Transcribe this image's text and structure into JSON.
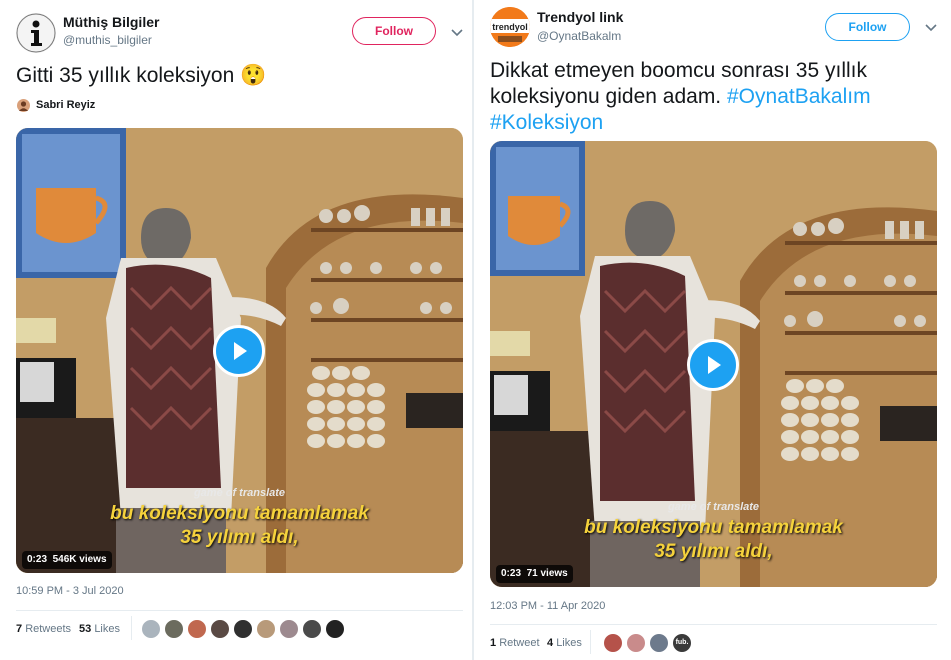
{
  "tweet1": {
    "name": "Müthiş Bilgiler",
    "handle": "@muthis_bilgiler",
    "follow_label": "Follow",
    "text": "Gitti 35 yıllık koleksiyon 😲",
    "retweeted_by": "Sabri Reyiz",
    "video": {
      "subtitle_small": "game of translate",
      "subtitle_line1": "bu koleksiyonu tamamlamak",
      "subtitle_line2": "35 yılımı aldı,",
      "duration": "0:23",
      "views": "546K views"
    },
    "timestamp": "10:59 PM - 3 Jul 2020",
    "retweets_count": "7",
    "retweets_label": "Retweets",
    "likes_count": "53",
    "likes_label": "Likes",
    "liker_colors": [
      "#aab4bd",
      "#6b6b5e",
      "#c0684f",
      "#5a4a44",
      "#303030",
      "#b89a7a",
      "#9d8a8f",
      "#4a4a4a",
      "#222222"
    ]
  },
  "tweet2": {
    "name": "Trendyol link",
    "handle": "@OynatBakalm",
    "follow_label": "Follow",
    "avatar_text": "trendyol",
    "text_plain": "Dikkat etmeyen boomcu sonrası 35 yıllık koleksiyonu giden adam.",
    "hashtag1": "#OynatBakalım",
    "hashtag2": "#Koleksiyon",
    "video": {
      "subtitle_small": "game of translate",
      "subtitle_line1": "bu koleksiyonu tamamlamak",
      "subtitle_line2": "35 yılımı aldı,",
      "duration": "0:23",
      "views": "71 views"
    },
    "timestamp": "12:03 PM - 11 Apr 2020",
    "retweets_count": "1",
    "retweets_label": "Retweet",
    "likes_count": "4",
    "likes_label": "Likes",
    "liker_colors": [
      "#b5524a",
      "#c98b8b",
      "#6d7a8c",
      "#3a3a3a"
    ],
    "liker4_text": "fub."
  },
  "colors": {
    "accent": "#1da1f2",
    "follow_red": "#e0245e",
    "muted": "#657786"
  }
}
